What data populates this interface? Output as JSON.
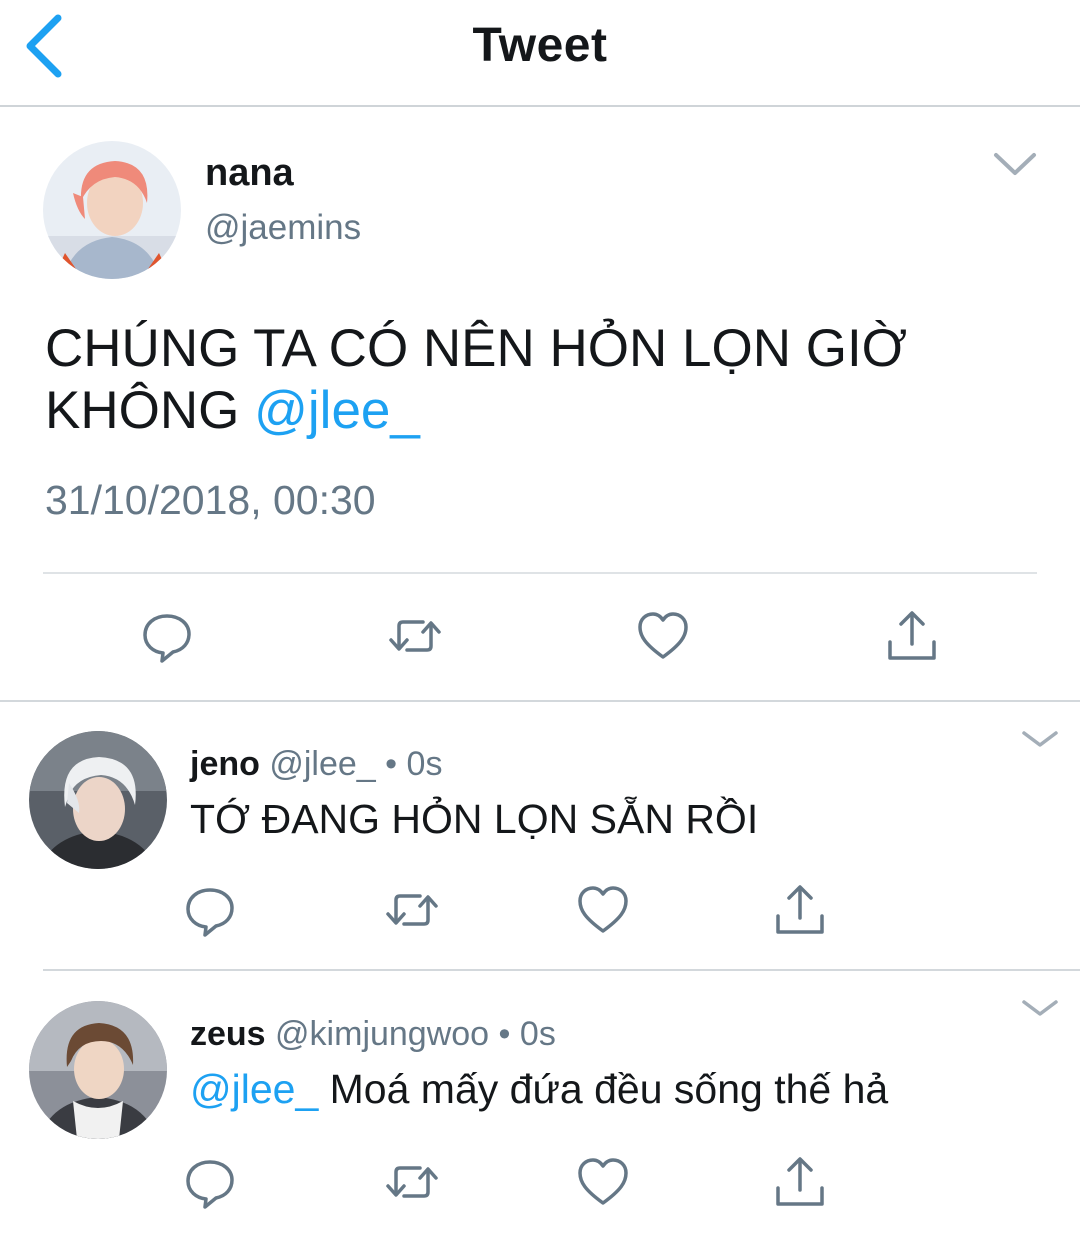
{
  "header": {
    "title": "Tweet"
  },
  "main_tweet": {
    "name": "nana",
    "handle": "@jaemins",
    "text": "CHÚNG TA CÓ NÊN HỎN LỌN GIỜ KHÔNG",
    "mention": "@jlee_",
    "timestamp": "31/10/2018, 00:30"
  },
  "replies": [
    {
      "name": "jeno",
      "handle": "@jlee_",
      "separator": "•",
      "time": "0s",
      "mention": "",
      "text": "TỚ ĐANG HỎN LỌN SẴN RỒI"
    },
    {
      "name": "zeus",
      "handle": "@kimjungwoo",
      "separator": "•",
      "time": "0s",
      "mention": "@jlee_",
      "text": "Moá mấy đứa đều sống thế hả"
    }
  ],
  "colors": {
    "accent": "#1da1f2",
    "text_primary": "#14171a",
    "text_secondary": "#657786",
    "divider": "#d3d8dc"
  },
  "icons": {
    "back": "chevron-left-icon",
    "caret": "chevron-down-icon",
    "reply": "reply-bubble-icon",
    "retweet": "retweet-icon",
    "like": "heart-icon",
    "share": "share-icon"
  }
}
